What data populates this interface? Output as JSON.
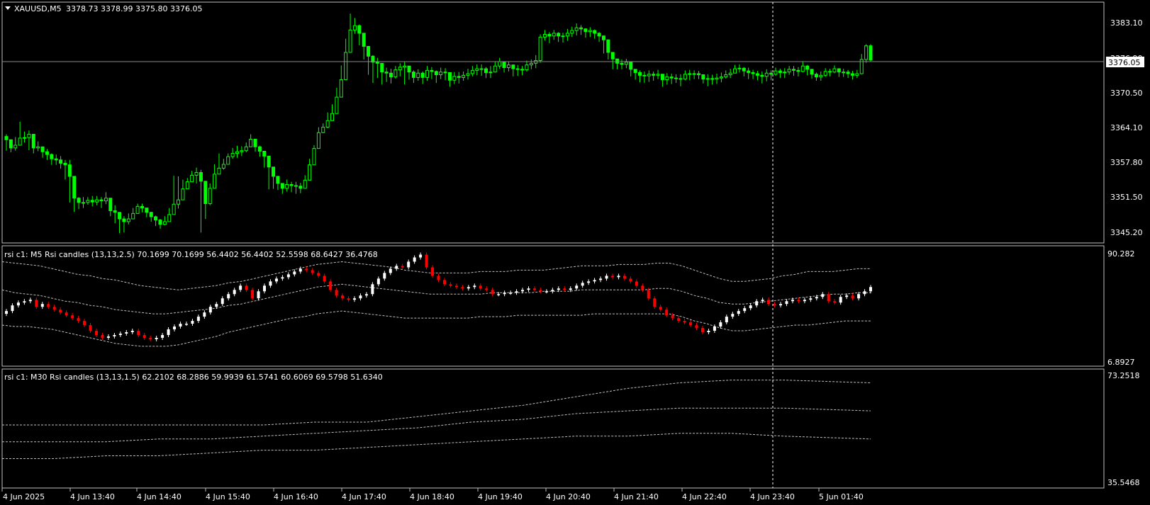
{
  "symbol_header": {
    "title": "XAUUSD,M5",
    "ohlc": "3378.73 3378.99 3375.80 3376.05",
    "current_price": "3376.05"
  },
  "colors": {
    "background": "#000000",
    "price_candle": "#00ff00",
    "rsi_up": "#ffffff",
    "rsi_down": "#ff0000",
    "band": "#bfbfbf",
    "crosshair": "#ffffff"
  },
  "panes": {
    "main": {
      "price_scale": [
        "3383.10",
        "3376.90",
        "3370.50",
        "3364.10",
        "3357.80",
        "3351.50",
        "3345.20"
      ]
    },
    "rsi_m5": {
      "label": "rsi c1: M5 Rsi candles (13,13,2.5) 70.1699 70.1699 56.4402 56.4402 52.5598 68.6427 36.4768",
      "scale": [
        "90.282",
        "6.8927"
      ]
    },
    "rsi_m30": {
      "label": "rsi c1: M30 Rsi candles (13,13,1.5) 62.2102 68.2886 59.9939 61.5741 60.6069 69.5798 51.6340",
      "scale": [
        "73.2518",
        "35.5468"
      ]
    }
  },
  "time_axis": [
    "4 Jun 2025",
    "4 Jun 13:40",
    "4 Jun 14:40",
    "4 Jun 15:40",
    "4 Jun 16:40",
    "4 Jun 17:40",
    "4 Jun 18:40",
    "4 Jun 19:40",
    "4 Jun 20:40",
    "4 Jun 21:40",
    "4 Jun 22:40",
    "4 Jun 23:40",
    "5 Jun 01:40"
  ],
  "chart_data": [
    {
      "type": "candlestick",
      "title": "XAUUSD,M5",
      "timeframe": "M5",
      "y_ticks": [
        3383.1,
        3376.9,
        3370.5,
        3364.1,
        3357.8,
        3351.5,
        3345.2
      ],
      "ylim": [
        3342.6,
        3386.7
      ],
      "last_price": 3376.05,
      "close": [
        3361.5,
        3360.0,
        3360.5,
        3361.8,
        3361.9,
        3362.5,
        3360.0,
        3360.2,
        3359.3,
        3358.8,
        3358.0,
        3357.8,
        3357.2,
        3356.9,
        3354.8,
        3350.8,
        3350.0,
        3350.0,
        3350.4,
        3350.1,
        3350.5,
        3350.3,
        3350.8,
        3348.5,
        3348.2,
        3347.0,
        3346.5,
        3347.0,
        3348.0,
        3349.3,
        3349.0,
        3348.2,
        3347.4,
        3346.8,
        3346.0,
        3346.5,
        3347.8,
        3349.7,
        3350.5,
        3352.5,
        3353.8,
        3355.0,
        3355.5,
        3353.9,
        3349.8,
        3352.6,
        3355.2,
        3356.3,
        3357.0,
        3358.4,
        3359.0,
        3359.3,
        3359.5,
        3360.2,
        3361.6,
        3360.2,
        3359.4,
        3358.5,
        3356.5,
        3354.8,
        3353.5,
        3352.6,
        3353.3,
        3353.1,
        3353.0,
        3352.6,
        3354.1,
        3356.9,
        3359.9,
        3362.8,
        3363.8,
        3365.0,
        3366.3,
        3369.3,
        3372.5,
        3377.5,
        3381.6,
        3382.4,
        3381.0,
        3378.6,
        3376.8,
        3375.7,
        3375.5,
        3373.9,
        3373.7,
        3373.0,
        3374.3,
        3374.8,
        3375.0,
        3373.9,
        3372.9,
        3373.7,
        3372.9,
        3374.2,
        3374.0,
        3373.4,
        3373.9,
        3373.8,
        3372.4,
        3373.1,
        3372.9,
        3373.3,
        3373.6,
        3374.2,
        3374.5,
        3374.5,
        3373.8,
        3373.9,
        3375.0,
        3375.8,
        3374.7,
        3375.2,
        3374.5,
        3374.4,
        3374.3,
        3375.2,
        3375.5,
        3376.0,
        3380.3,
        3380.8,
        3380.5,
        3381.0,
        3380.5,
        3380.5,
        3381.0,
        3381.5,
        3382.0,
        3381.8,
        3381.3,
        3381.5,
        3381.0,
        3380.5,
        3379.8,
        3377.5,
        3376.3,
        3375.5,
        3375.3,
        3375.7,
        3374.4,
        3373.8,
        3373.3,
        3373.2,
        3373.5,
        3373.3,
        3373.5,
        3372.5,
        3373.0,
        3372.8,
        3372.7,
        3372.6,
        3373.5,
        3373.6,
        3373.6,
        3373.4,
        3372.6,
        3372.7,
        3372.6,
        3372.8,
        3373.0,
        3373.4,
        3373.7,
        3374.5,
        3374.6,
        3374.1,
        3373.8,
        3373.6,
        3373.3,
        3373.1,
        3373.7,
        3373.5,
        3374.1,
        3373.8,
        3373.9,
        3374.4,
        3374.2,
        3374.0,
        3375.0,
        3374.4,
        3373.5,
        3373.0,
        3373.3,
        3374.0,
        3373.9,
        3374.5,
        3373.9,
        3373.9,
        3373.6,
        3373.3,
        3373.6,
        3376.2,
        3378.7,
        3376.1
      ],
      "hi_lo_range_note": "high/low per bar",
      "high": [
        3362.5,
        3361.5,
        3362.0,
        3364.8,
        3363.0,
        3363.2,
        3361.5,
        3361.2,
        3360.1,
        3359.8,
        3359.0,
        3358.8,
        3358.5,
        3357.8,
        3357.8,
        3352.0,
        3351.0,
        3351.0,
        3351.0,
        3351.2,
        3351.2,
        3351.0,
        3351.9,
        3350.2,
        3349.5,
        3348.2,
        3347.5,
        3348.0,
        3349.0,
        3349.8,
        3349.8,
        3349.0,
        3348.3,
        3347.6,
        3347.0,
        3347.5,
        3349.0,
        3354.9,
        3354.8,
        3354.2,
        3354.5,
        3355.8,
        3356.4,
        3356.0,
        3353.0,
        3353.5,
        3357.0,
        3359.0,
        3358.0,
        3359.0,
        3360.0,
        3360.4,
        3360.3,
        3361.0,
        3362.5,
        3361.0,
        3360.4,
        3359.4,
        3358.0,
        3356.0,
        3354.5,
        3353.5,
        3354.2,
        3353.8,
        3353.8,
        3353.6,
        3355.0,
        3358.0,
        3360.5,
        3363.8,
        3364.5,
        3366.5,
        3368.0,
        3371.0,
        3375.1,
        3380.0,
        3384.6,
        3383.8,
        3382.6,
        3380.8,
        3378.5,
        3377.0,
        3376.5,
        3374.8,
        3374.7,
        3374.5,
        3375.0,
        3375.5,
        3375.8,
        3375.0,
        3374.2,
        3374.4,
        3374.0,
        3375.0,
        3374.8,
        3374.2,
        3374.7,
        3374.6,
        3373.2,
        3373.9,
        3373.9,
        3374.0,
        3374.5,
        3375.0,
        3375.3,
        3375.3,
        3374.8,
        3375.0,
        3375.8,
        3376.5,
        3375.5,
        3375.8,
        3375.3,
        3375.2,
        3375.0,
        3376.0,
        3376.2,
        3377.0,
        3380.8,
        3381.6,
        3381.2,
        3381.6,
        3381.2,
        3381.1,
        3381.8,
        3382.2,
        3382.8,
        3382.5,
        3381.9,
        3382.1,
        3381.7,
        3381.2,
        3380.6,
        3378.8,
        3377.0,
        3376.3,
        3376.2,
        3376.3,
        3375.2,
        3374.4,
        3374.2,
        3374.0,
        3374.2,
        3374.0,
        3374.3,
        3373.5,
        3373.7,
        3373.6,
        3373.5,
        3373.5,
        3374.2,
        3374.3,
        3374.2,
        3374.1,
        3373.5,
        3373.5,
        3373.4,
        3373.6,
        3373.8,
        3374.2,
        3374.5,
        3375.2,
        3375.3,
        3374.8,
        3374.7,
        3374.3,
        3374.1,
        3374.0,
        3374.4,
        3374.2,
        3374.7,
        3374.5,
        3374.6,
        3375.0,
        3375.0,
        3374.8,
        3375.9,
        3375.2,
        3374.4,
        3373.8,
        3374.0,
        3374.6,
        3374.5,
        3375.1,
        3374.6,
        3374.5,
        3374.3,
        3374.1,
        3374.3,
        3377.2,
        3379.0,
        3379.0
      ],
      "low": [
        3359.5,
        3359.2,
        3359.5,
        3360.5,
        3361.0,
        3359.6,
        3359.0,
        3359.4,
        3358.2,
        3357.8,
        3356.9,
        3356.9,
        3356.2,
        3354.2,
        3350.0,
        3348.3,
        3348.8,
        3349.0,
        3349.6,
        3349.3,
        3349.5,
        3349.0,
        3349.7,
        3347.5,
        3346.2,
        3344.4,
        3344.5,
        3346.0,
        3347.2,
        3348.0,
        3348.2,
        3347.3,
        3346.5,
        3345.7,
        3345.2,
        3345.8,
        3346.8,
        3349.0,
        3348.9,
        3351.6,
        3352.8,
        3354.0,
        3353.5,
        3344.5,
        3347.0,
        3349.5,
        3354.2,
        3355.5,
        3356.0,
        3357.5,
        3358.0,
        3358.2,
        3358.5,
        3359.2,
        3360.5,
        3359.3,
        3358.4,
        3356.4,
        3352.4,
        3352.5,
        3352.3,
        3351.6,
        3352.0,
        3351.9,
        3351.6,
        3351.7,
        3353.1,
        3355.9,
        3358.6,
        3361.5,
        3362.7,
        3363.6,
        3365.1,
        3368.0,
        3371.4,
        3375.6,
        3379.2,
        3380.9,
        3378.8,
        3376.2,
        3373.4,
        3371.9,
        3372.8,
        3371.6,
        3372.1,
        3371.8,
        3372.7,
        3373.1,
        3371.6,
        3372.5,
        3371.9,
        3372.3,
        3371.7,
        3372.3,
        3372.6,
        3371.9,
        3372.6,
        3372.4,
        3371.2,
        3371.7,
        3371.8,
        3372.3,
        3372.5,
        3373.1,
        3373.3,
        3373.2,
        3372.8,
        3372.8,
        3373.8,
        3374.5,
        3373.8,
        3374.0,
        3373.1,
        3373.2,
        3373.3,
        3374.0,
        3374.4,
        3374.6,
        3375.6,
        3379.7,
        3379.2,
        3379.8,
        3379.4,
        3379.3,
        3379.6,
        3380.3,
        3380.6,
        3380.7,
        3380.2,
        3380.3,
        3380.0,
        3379.4,
        3377.3,
        3376.2,
        3374.4,
        3374.4,
        3374.4,
        3374.6,
        3373.1,
        3372.5,
        3372.0,
        3371.9,
        3372.1,
        3372.3,
        3372.6,
        3371.2,
        3371.6,
        3371.7,
        3371.9,
        3371.3,
        3372.4,
        3372.4,
        3372.6,
        3372.6,
        3371.8,
        3371.3,
        3371.6,
        3371.7,
        3372.0,
        3372.7,
        3372.8,
        3373.7,
        3373.8,
        3373.1,
        3372.6,
        3372.6,
        3372.4,
        3371.8,
        3372.2,
        3372.4,
        3373.2,
        3372.8,
        3372.8,
        3373.4,
        3373.2,
        3373.1,
        3373.8,
        3373.3,
        3372.7,
        3372.3,
        3372.3,
        3373.0,
        3373.1,
        3373.7,
        3373.0,
        3373.0,
        3372.8,
        3372.5,
        3372.8,
        3373.5,
        3375.6,
        3375.8
      ]
    },
    {
      "type": "candlestick",
      "title": "rsi c1: M5 Rsi candles (13,13,2.5)",
      "timeframe": "M5",
      "ylim": [
        6.8927,
        90.282
      ],
      "values_in_label": [
        70.1699,
        70.1699,
        56.4402,
        56.4402,
        52.5598,
        68.6427,
        36.4768
      ],
      "rsi_close": [
        45,
        49,
        51,
        52,
        53,
        48,
        50,
        48,
        46,
        44,
        42,
        40,
        38,
        35,
        31,
        28,
        26,
        27,
        28,
        29,
        30,
        31,
        28,
        26,
        25,
        26,
        28,
        32,
        34,
        36,
        36,
        38,
        41,
        44,
        48,
        50,
        54,
        57,
        60,
        63,
        60,
        54,
        59,
        63,
        66,
        68,
        69,
        71,
        73,
        75,
        74,
        72,
        70,
        66,
        60,
        56,
        54,
        53,
        54,
        56,
        57,
        64,
        68,
        72,
        75,
        77,
        76,
        80,
        83,
        85,
        76,
        70,
        67,
        64,
        63,
        62,
        61,
        62,
        63,
        61,
        60,
        57,
        57,
        58,
        58,
        59,
        60,
        61,
        60,
        59,
        59,
        60,
        61,
        60,
        61,
        63,
        65,
        66,
        67,
        68,
        70,
        69,
        70,
        68,
        66,
        63,
        60,
        54,
        48,
        46,
        42,
        40,
        38,
        37,
        35,
        33,
        30,
        31,
        34,
        37,
        41,
        43,
        45,
        47,
        49,
        52,
        53,
        50,
        49,
        50,
        52,
        53,
        52,
        53,
        54,
        55,
        57,
        52,
        51,
        55,
        56,
        54,
        57,
        59,
        62
      ],
      "upper_band": [
        80,
        79,
        78,
        77,
        75,
        73,
        71,
        70,
        68,
        67,
        65,
        63,
        62,
        61,
        60,
        61,
        62,
        63,
        65,
        66,
        68,
        70,
        72,
        74,
        76,
        78,
        79,
        80,
        79,
        78,
        77,
        76,
        74,
        73,
        72,
        72,
        72,
        72,
        73,
        73,
        73,
        74,
        74,
        74,
        75,
        76,
        77,
        77,
        77,
        78,
        78,
        78,
        79,
        79,
        77,
        74,
        71,
        68,
        66,
        66,
        67,
        68,
        70,
        71,
        73,
        73,
        73,
        74,
        75,
        75
      ],
      "mid_band": [
        60,
        58,
        57,
        56,
        54,
        52,
        51,
        49,
        48,
        46,
        45,
        44,
        43,
        43,
        44,
        45,
        46,
        47,
        49,
        50,
        52,
        54,
        56,
        58,
        60,
        62,
        63,
        64,
        63,
        62,
        61,
        60,
        59,
        58,
        57,
        57,
        57,
        57,
        57,
        58,
        58,
        58,
        58,
        59,
        59,
        59,
        60,
        60,
        60,
        60,
        60,
        60,
        61,
        61,
        59,
        56,
        54,
        51,
        50,
        50,
        51,
        52,
        53,
        54,
        55,
        56,
        57,
        57,
        58,
        58
      ],
      "lower_band": [
        35,
        34,
        34,
        33,
        32,
        30,
        28,
        26,
        24,
        22,
        21,
        20,
        20,
        20,
        21,
        23,
        25,
        27,
        30,
        32,
        34,
        36,
        38,
        40,
        41,
        43,
        44,
        45,
        44,
        43,
        42,
        41,
        40,
        40,
        40,
        40,
        40,
        40,
        41,
        41,
        41,
        42,
        42,
        42,
        42,
        42,
        42,
        43,
        43,
        43,
        43,
        43,
        43,
        43,
        41,
        38,
        36,
        33,
        31,
        31,
        32,
        33,
        34,
        35,
        35,
        36,
        37,
        38,
        38,
        38
      ]
    },
    {
      "type": "line",
      "title": "rsi c1: M30 Rsi candles (13,13,1.5)",
      "timeframe": "M30",
      "ylim": [
        35.5468,
        73.2518
      ],
      "values_in_label": [
        62.2102,
        68.2886,
        59.9939,
        61.5741,
        60.6069,
        69.5798,
        51.634
      ],
      "upper_band": [
        56,
        56,
        56,
        56,
        56,
        56,
        57,
        57,
        59,
        61,
        63,
        66,
        69,
        71,
        72,
        72,
        71
      ],
      "mid_band": [
        50,
        50,
        50,
        51,
        51,
        52,
        53,
        54,
        55,
        57,
        58,
        60,
        61,
        62,
        62,
        62,
        61
      ],
      "lower_band": [
        44,
        44,
        45,
        45,
        46,
        47,
        47,
        48,
        49,
        50,
        51,
        52,
        52,
        53,
        53,
        52,
        51
      ],
      "band_x_fraction": [
        0.0,
        0.06,
        0.12,
        0.18,
        0.24,
        0.3,
        0.36,
        0.42,
        0.48,
        0.54,
        0.6,
        0.66,
        0.72,
        0.78,
        0.84,
        0.9,
        1.0
      ]
    }
  ]
}
